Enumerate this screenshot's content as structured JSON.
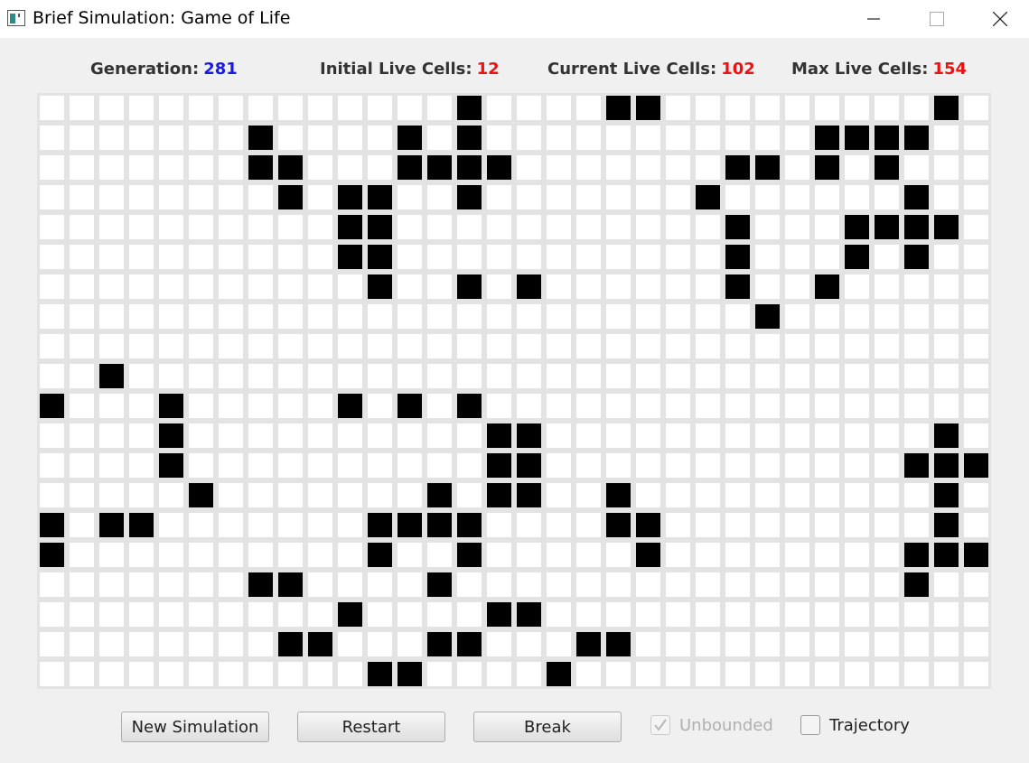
{
  "window": {
    "title": "Brief Simulation: Game of Life",
    "icon": "app-window-icon",
    "controls": [
      "minimize-icon",
      "maximize-icon",
      "close-icon"
    ]
  },
  "stats": {
    "generation_label": "Generation:",
    "generation_value": "281",
    "initial_label": "Initial Live Cells:",
    "initial_value": "12",
    "current_label": "Current Live Cells:",
    "current_value": "102",
    "max_label": "Max Live Cells:",
    "max_value": "154"
  },
  "colors": {
    "generation_value": "#1a1ae6",
    "cell_counts": "#ee1111",
    "live_cell": "#000000",
    "dead_cell": "#ffffff",
    "grid_lines": "#e3e3e3"
  },
  "grid": {
    "cols": 32,
    "rows": 20,
    "rows_data": [
      "..............#....##.........#.",
      ".......#....#.#...........####..",
      ".......##...####.......##.#.#...",
      "........#.##..#.......#......#..",
      "..........##...........#...####.",
      "..........##...........#...#.#..",
      "...........#..#.#......#..#.....",
      "........................#.......",
      "................................",
      "..#.............................",
      "#...#.....#.#.#.................",
      "....#..........##.............#.#",
      "....#..........##............####",
      ".....#.......#.##..#..........#.",
      "#.##.......####....##.........#.",
      "#..........#..#.....#........###",
      ".......##....#...............#..",
      "..........#....##...............",
      "........##...##...##............",
      "...........##....#.............."
    ]
  },
  "controls": {
    "new_simulation": "New Simulation",
    "restart": "Restart",
    "break": "Break",
    "unbounded_label": "Unbounded",
    "unbounded_checked": true,
    "unbounded_enabled": false,
    "trajectory_label": "Trajectory",
    "trajectory_checked": false
  }
}
